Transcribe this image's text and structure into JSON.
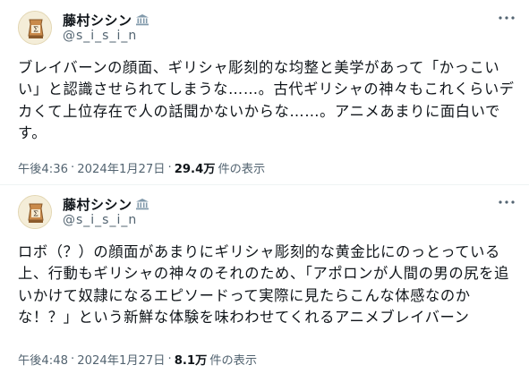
{
  "tweets": [
    {
      "author": {
        "display_name": "藤村シシン",
        "handle": "@s_i_s_i_n"
      },
      "body_lines": [
        "ブレイバーンの顔面、ギリシャ彫刻的な均整と美学があって「かっこい",
        "い」と認識させられてしまうな……。古代ギリシャの神々もこれくらいデ",
        "カくて上位存在で人の話聞かないからな……。アニメあまりに面白いで",
        "す。"
      ],
      "time": "午後4:36",
      "date": "2024年1月27日",
      "separator": "·",
      "views_count": "29.4万",
      "views_label": "件の表示"
    },
    {
      "author": {
        "display_name": "藤村シシン",
        "handle": "@s_i_s_i_n"
      },
      "body_lines": [
        "ロボ（？）の顔面があまりにギリシャ彫刻的な黄金比にのっとっている",
        "上、行動もギリシャの神々のそれのため、「アポロンが人間の男の尻を追",
        "いかけて奴隷になるエピソードって実際に見たらこんな体感なのか",
        "な！？」という新鮮な体験を味わわせてくれるアニメブレイバーン"
      ],
      "time": "午後4:48",
      "date": "2024年1月27日",
      "separator": "·",
      "views_count": "8.1万",
      "views_label": "件の表示"
    }
  ],
  "icons": {
    "avatar": "lamp-avatar-icon",
    "badge": "museum-icon",
    "more": "more-horizontal-icon"
  },
  "colors": {
    "text": "#0f1419",
    "secondary": "#536471",
    "badge": "#829aab",
    "divider": "#eff3f4"
  }
}
